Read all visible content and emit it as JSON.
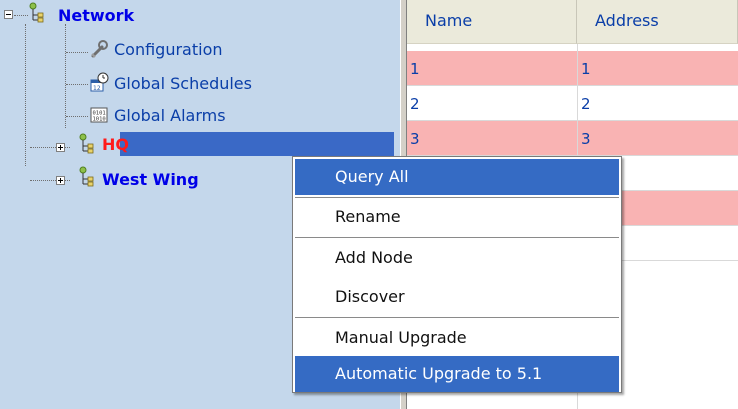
{
  "tree": {
    "root": {
      "label": "Network"
    },
    "children": [
      {
        "label": "Configuration",
        "icon": "wrench-icon"
      },
      {
        "label": "Global Schedules",
        "icon": "calendar-clock-icon"
      },
      {
        "label": "Global Alarms",
        "icon": "alarm-panel-icon"
      }
    ],
    "sites": [
      {
        "label": "HQ",
        "color": "#ff1a1a",
        "selected": true
      },
      {
        "label": "West Wing",
        "color": "#0000e8",
        "selected": false
      }
    ]
  },
  "grid": {
    "columns": [
      "Name",
      "Address"
    ],
    "rows": [
      {
        "name": "1",
        "address": "1"
      },
      {
        "name": "2",
        "address": "2"
      },
      {
        "name": "3",
        "address": "3"
      }
    ]
  },
  "context_menu": {
    "items": [
      {
        "label": "Query All",
        "highlighted": true
      },
      {
        "label": "Rename"
      },
      {
        "label": "Add Node"
      },
      {
        "label": "Discover"
      },
      {
        "label": "Manual Upgrade"
      },
      {
        "label": "Automatic Upgrade to 5.1",
        "highlighted": true
      }
    ]
  },
  "colors": {
    "tree_bg": "#c4d7eb",
    "selection": "#3a69c6",
    "pink_row": "#f9b3b3",
    "menu_highlight": "#356bc4"
  }
}
